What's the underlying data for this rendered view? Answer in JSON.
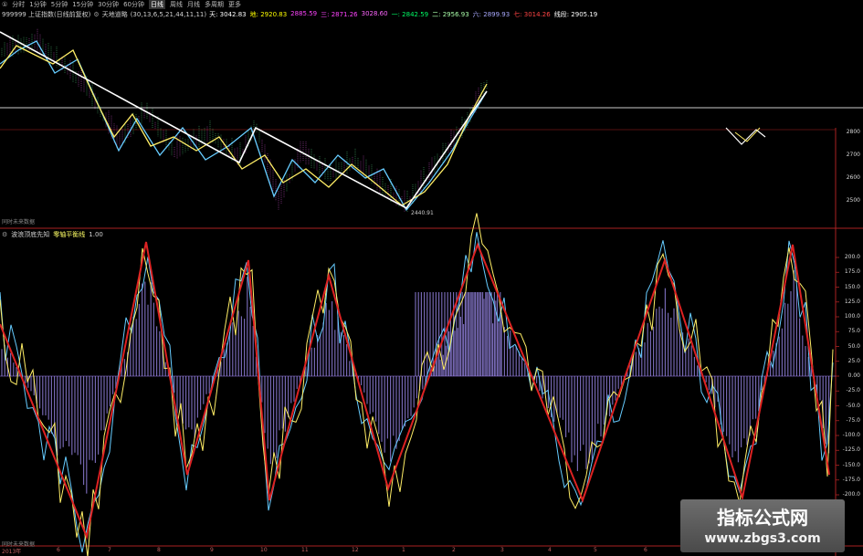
{
  "toolbar": {
    "items": [
      "①",
      "分时",
      "1分钟",
      "5分钟",
      "15分钟",
      "30分钟",
      "60分钟",
      "日线",
      "周线",
      "月线",
      "多周期",
      "更多"
    ],
    "active_index": 7
  },
  "top_panel": {
    "index_name": "999999 上证指数(日线前复权)",
    "indicator_name": "天地道略",
    "params": "(30,13,6,5,21,44,11,11)",
    "values": [
      {
        "label": "天:",
        "value": "3042.83",
        "color": "#ffffff"
      },
      {
        "label": "地:",
        "value": "2920.83",
        "color": "#ffff00"
      },
      {
        "label": "",
        "value": "2885.59",
        "color": "#ff44ff"
      },
      {
        "label": "三:",
        "value": "2871.26",
        "color": "#ff44ff"
      },
      {
        "label": "",
        "value": "3028.60",
        "color": "#ff66ff"
      },
      {
        "label": "一:",
        "value": "2842.59",
        "color": "#00ff66"
      },
      {
        "label": "二:",
        "value": "2956.93",
        "color": "#aaffaa"
      },
      {
        "label": "六:",
        "value": "2899.93",
        "color": "#aaaaff"
      },
      {
        "label": "七:",
        "value": "3014.26",
        "color": "#ff4444"
      },
      {
        "label": "线段:",
        "value": "2905.19",
        "color": "#ffffff"
      }
    ],
    "future_label": "同时未来数据",
    "low_label": "2440.91",
    "y_ticks": [
      "2800",
      "2700",
      "2600",
      "2500"
    ]
  },
  "bottom_panel": {
    "indicator_name": "波浪顶底先知",
    "zero_axis_label": "零轴平衡线",
    "zero_axis_value": "1.00",
    "future_label": "同时未来数据",
    "y_ticks": [
      "200.0",
      "175.0",
      "150.0",
      "125.0",
      "100.0",
      "75.0",
      "50.0",
      "25.0",
      "0.00",
      "-25.0",
      "-50.0",
      "-75.0",
      "-100.0",
      "-125.0",
      "-150.0",
      "-175.0",
      "-200.0"
    ],
    "x_ticks": [
      "2013年",
      "6",
      "7",
      "8",
      "9",
      "10",
      "11",
      "12",
      "1",
      "2",
      "3",
      "4",
      "5",
      "6",
      "7"
    ]
  },
  "watermark": {
    "title": "指标公式网",
    "url": "www.zbgs3.com"
  },
  "colors": {
    "red_zigzag": "#dd2222",
    "histogram": "#8a7ad0",
    "cyan_line": "#66ccff",
    "yellow_line": "#ffee66",
    "white_line": "#ffffff",
    "panel_border": "#aa2222"
  }
}
